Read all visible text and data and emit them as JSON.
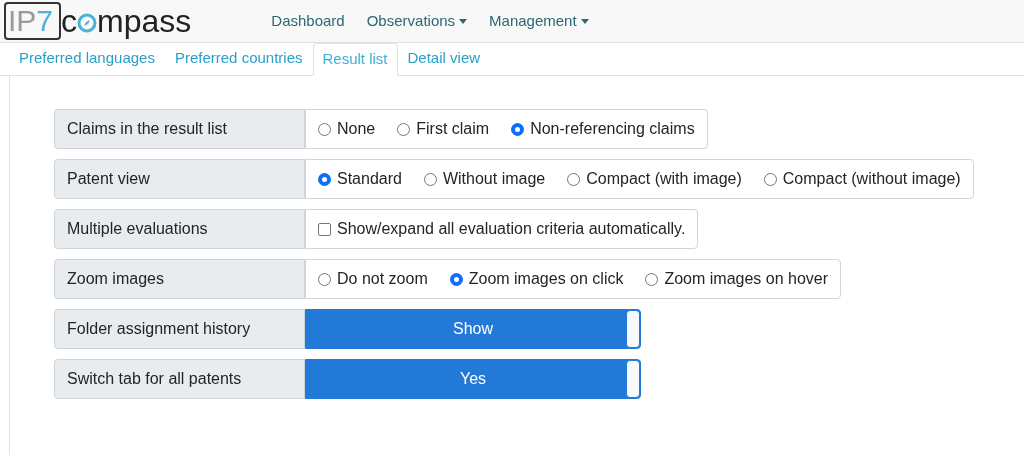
{
  "logo": {
    "prefix": "IP",
    "digit": "7",
    "word_start": "c",
    "word_end": "mpass"
  },
  "nav": [
    {
      "label": "Dashboard",
      "dropdown": false
    },
    {
      "label": "Observations",
      "dropdown": true
    },
    {
      "label": "Management",
      "dropdown": true
    }
  ],
  "tabs": [
    {
      "label": "Preferred languages",
      "selected": false
    },
    {
      "label": "Preferred countries",
      "selected": false
    },
    {
      "label": "Result list",
      "selected": true
    },
    {
      "label": "Detail view",
      "selected": false
    }
  ],
  "settings": [
    {
      "kind": "radio",
      "label": "Claims in the result list",
      "options": [
        {
          "label": "None",
          "selected": false
        },
        {
          "label": "First claim",
          "selected": false
        },
        {
          "label": "Non-referencing claims",
          "selected": true
        }
      ]
    },
    {
      "kind": "radio",
      "label": "Patent view",
      "options": [
        {
          "label": "Standard",
          "selected": true
        },
        {
          "label": "Without image",
          "selected": false
        },
        {
          "label": "Compact (with image)",
          "selected": false
        },
        {
          "label": "Compact (without image)",
          "selected": false
        }
      ]
    },
    {
      "kind": "checkbox",
      "label": "Multiple evaluations",
      "text": "Show/expand all evaluation criteria automatically.",
      "checked": false
    },
    {
      "kind": "radio",
      "label": "Zoom images",
      "options": [
        {
          "label": "Do not zoom",
          "selected": false
        },
        {
          "label": "Zoom images on click",
          "selected": true
        },
        {
          "label": "Zoom images on hover",
          "selected": false
        }
      ]
    },
    {
      "kind": "toggle",
      "label": "Folder assignment history",
      "text": "Show",
      "on": true
    },
    {
      "kind": "toggle",
      "label": "Switch tab for all patents",
      "text": "Yes",
      "on": true
    }
  ]
}
